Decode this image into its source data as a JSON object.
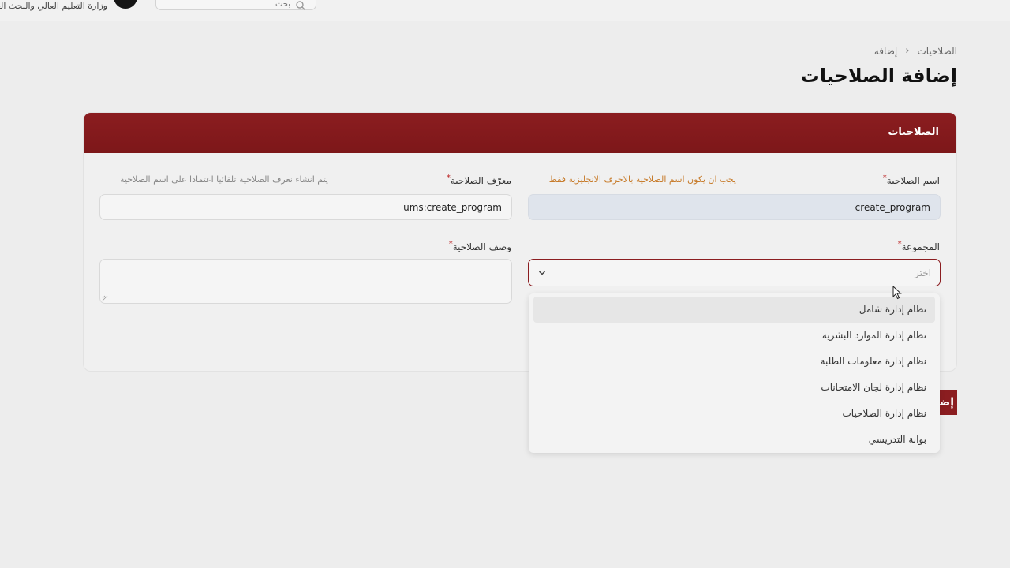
{
  "header": {
    "ministry_text": "وزارة التعليم العالي والبحث العلمي",
    "search_placeholder": "بحث"
  },
  "breadcrumb": {
    "items": [
      "الصلاحيات",
      "إضافة"
    ]
  },
  "page_title": "إضافة الصلاحيات",
  "card": {
    "title": "الصلاحيات",
    "fields": {
      "permission_name": {
        "label": "اسم الصلاحية",
        "hint": "يجب ان يكون اسم الصلاحية بالاحرف الانجليزية فقط",
        "value": "create_program"
      },
      "permission_id": {
        "label": "معرّف الصلاحية",
        "hint": "يتم انشاء نعرف الصلاحية تلقائيا اعتمادا على اسم الصلاحية",
        "value": "ums:create_program"
      },
      "group": {
        "label": "المجموعة",
        "placeholder": "اختر"
      },
      "description": {
        "label": "وصف الصلاحية",
        "value": ""
      }
    }
  },
  "dropdown": {
    "options": [
      "نظام إدارة شامل",
      "نظام إدارة الموارد البشرية",
      "نظام إدارة معلومات الطلبة",
      "نظام إدارة لجان الامتحانات",
      "نظام إدارة الصلاحيات",
      "بوابة التدريسي"
    ]
  },
  "actions": {
    "add_label": "إضافة"
  },
  "colors": {
    "accent": "#8b1d20",
    "warn_hint": "#c77b2a",
    "filled_input": "#dfe4ec"
  }
}
